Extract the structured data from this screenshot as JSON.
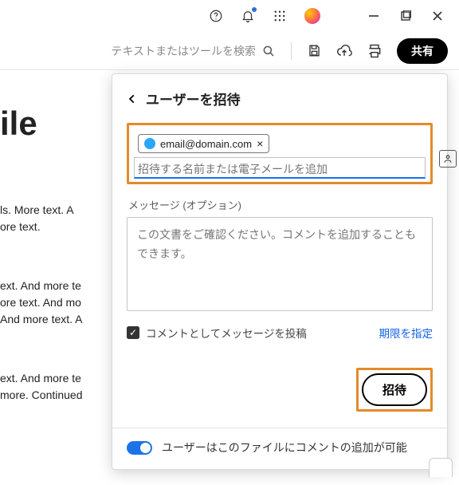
{
  "sysbar": {
    "icons": [
      "help-icon",
      "bell-icon",
      "apps-icon",
      "profile-icon"
    ],
    "win": [
      "minimize",
      "maximize",
      "close"
    ]
  },
  "toolbar": {
    "search_placeholder": "テキストまたはツールを検索",
    "share_label": "共有"
  },
  "doc": {
    "title_fragment": "ile",
    "para1": "ls. More text. A\nore text.",
    "para2": "ext. And more te\nore text. And mo\nAnd more text. A",
    "para3": "ext. And more te\nmore. Continued"
  },
  "panel": {
    "title": "ユーザーを招待",
    "chip_email": "email@domain.com",
    "email_placeholder": "招待する名前または電子メールを追加",
    "message_label": "メッセージ (オプション)",
    "message_placeholder": "この文書をご確認ください。コメントを追加することもできます。",
    "post_checkbox_label": "コメントとしてメッセージを投稿",
    "deadline_link": "期限を指定",
    "invite_button": "招待",
    "permission_text": "ユーザーはこのファイルにコメントの追加が可能",
    "post_checked": true,
    "toggle_on": true
  }
}
